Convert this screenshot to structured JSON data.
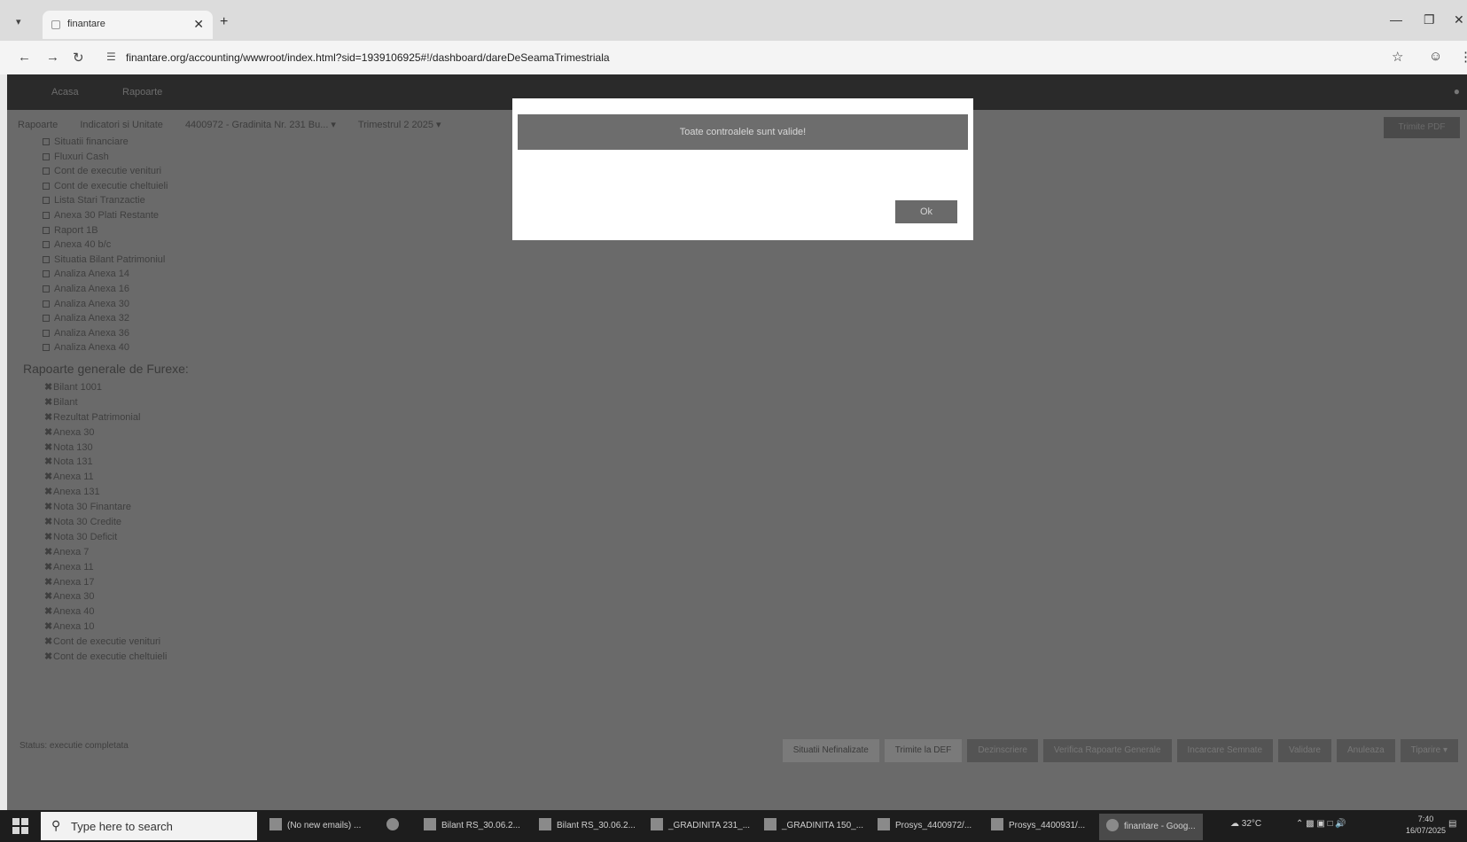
{
  "browser": {
    "tab_title": "finantare",
    "url": "finantare.org/accounting/wwwroot/index.html?sid=1939106925#!/dashboard/dareDeSeamaTrimestriala"
  },
  "app": {
    "nav": [
      "Acasa",
      "Rapoarte"
    ],
    "filter": [
      "Rapoarte",
      "Indicatori si Unitate",
      "4400972 - Gradinita Nr. 231 Bu... ▾",
      "Trimestrul 2 2025 ▾"
    ],
    "top_right_button": "Trimite PDF",
    "tree_items": [
      "Situatii financiare",
      "Fluxuri Cash",
      "Cont de executie venituri",
      "Cont de executie cheltuieli",
      "Lista Stari Tranzactie",
      "Anexa 30 Plati Restante",
      "Raport 1B",
      "Anexa 40 b/c",
      "Situatia Bilant Patrimoniul",
      "Analiza Anexa 14",
      "Analiza Anexa 16",
      "Analiza Anexa 30",
      "Analiza Anexa 32",
      "Analiza Anexa 36",
      "Analiza Anexa 40"
    ],
    "section_title": "Rapoarte generale de Furexe:",
    "tree2_items": [
      "Bilant 1001",
      "Bilant",
      "Rezultat Patrimonial",
      "Anexa 30",
      "Nota 130",
      "Nota 131",
      "Anexa 11",
      "Anexa 131",
      "Nota 30 Finantare",
      "Nota 30 Credite",
      "Nota 30 Deficit",
      "Anexa 7",
      "Anexa 11",
      "Anexa 17",
      "Anexa 30",
      "Anexa 40",
      "Anexa 10",
      "Cont de executie venituri",
      "Cont de executie cheltuieli"
    ],
    "bottom_status": "Status: executie completata",
    "bottom_actions": [
      "Situatii Nefinalizate",
      "Trimite la DEF",
      "Dezinscriere",
      "Verifica Rapoarte Generale",
      "Incarcare Semnate",
      "Validare",
      "Anuleaza",
      "Tiparire ▾"
    ]
  },
  "modal": {
    "message": "Toate controalele sunt valide!",
    "ok_label": "Ok"
  },
  "taskbar": {
    "search_placeholder": "Type here to search",
    "items": [
      "(No new emails) ...",
      "Bilant RS_30.06.2...",
      "Bilant RS_30.06.2...",
      "_GRADINITA 231_...",
      "_GRADINITA 150_...",
      "Prosys_4400972/...",
      "Prosys_4400931/...",
      "finantare - Goog..."
    ],
    "weather": "32°C",
    "time": "7:40",
    "date": "16/07/2025"
  }
}
